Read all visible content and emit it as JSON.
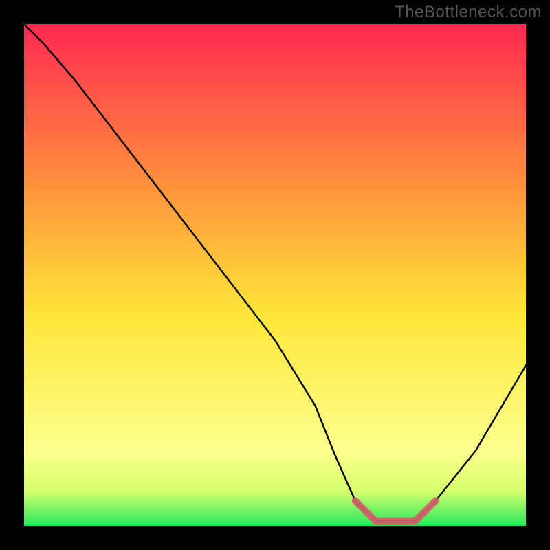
{
  "watermark": "TheBottleneck.com",
  "chart_data": {
    "type": "line",
    "title": "",
    "xlabel": "",
    "ylabel": "",
    "xlim": [
      0,
      100
    ],
    "ylim": [
      0,
      100
    ],
    "series": [
      {
        "name": "curve",
        "x": [
          0,
          4,
          10,
          20,
          30,
          40,
          50,
          58,
          62,
          66,
          70,
          74,
          78,
          82,
          90,
          100
        ],
        "y": [
          100,
          96,
          89,
          76,
          63,
          50,
          37,
          24,
          14,
          5,
          1,
          1,
          1,
          5,
          15,
          32
        ]
      },
      {
        "name": "optimal-band",
        "x": [
          66,
          70,
          74,
          78,
          82
        ],
        "y": [
          5,
          1,
          1,
          1,
          5
        ]
      }
    ],
    "colors": {
      "curve": "#000000",
      "optimal_band": "#cf6168",
      "gradient_top": "#ff2952",
      "gradient_mid_upper": "#ff8a3d",
      "gradient_mid": "#ffe639",
      "gradient_lower": "#fdff8e",
      "gradient_bottom": "#28e85a"
    }
  }
}
